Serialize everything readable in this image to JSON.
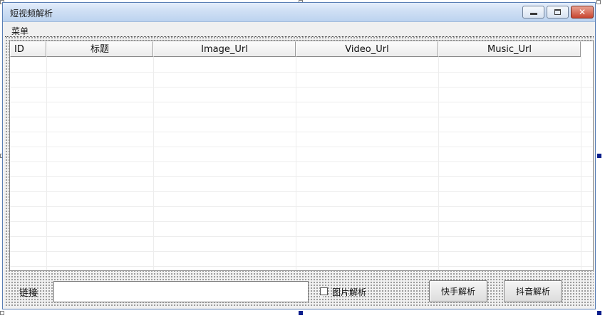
{
  "window": {
    "title": "短视频解析"
  },
  "menu": {
    "items": [
      "菜单"
    ]
  },
  "table": {
    "columns": [
      "ID",
      "标题",
      "Image_Url",
      "Video_Url",
      "Music_Url"
    ],
    "rows": []
  },
  "bottom": {
    "link_label": "链接",
    "link_value": "",
    "image_parse_label": "图片解析",
    "image_parse_checked": false,
    "kuaishou_button": "快手解析",
    "douyin_button": "抖音解析"
  },
  "colors": {
    "titlebar_top": "#e4eefb",
    "titlebar_bottom": "#bcd3ef",
    "close_button": "#c8452f",
    "selection_handle": "#0b1f8c",
    "form_background": "#f0f0f0"
  }
}
